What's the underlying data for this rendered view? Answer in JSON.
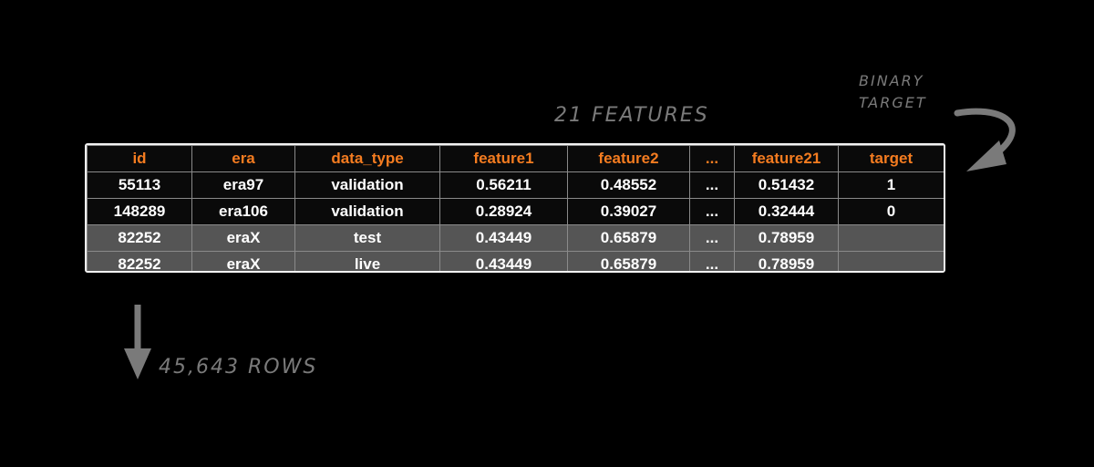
{
  "annotations": {
    "features_label": "21 features",
    "rows_label": "45,643 rows",
    "target_label_line1": "binary",
    "target_label_line2": "target"
  },
  "table": {
    "headers": [
      "id",
      "era",
      "data_type",
      "feature1",
      "feature2",
      "...",
      "feature21",
      "target"
    ],
    "rows": [
      [
        "55113",
        "era97",
        "validation",
        "0.56211",
        "0.48552",
        "...",
        "0.51432",
        "1"
      ],
      [
        "148289",
        "era106",
        "validation",
        "0.28924",
        "0.39027",
        "...",
        "0.32444",
        "0"
      ],
      [
        "82252",
        "eraX",
        "test",
        "0.43449",
        "0.65879",
        "...",
        "0.78959",
        ""
      ],
      [
        "82252",
        "eraX",
        "live",
        "0.43449",
        "0.65879",
        "...",
        "0.78959",
        ""
      ]
    ]
  },
  "colors": {
    "background": "#000000",
    "header_text": "#f47c20",
    "dark_row_bg": "#0a0a0a",
    "grey_row_bg": "#555555",
    "annotation_text": "#7a7a7a",
    "table_border": "#f2f2f2"
  }
}
